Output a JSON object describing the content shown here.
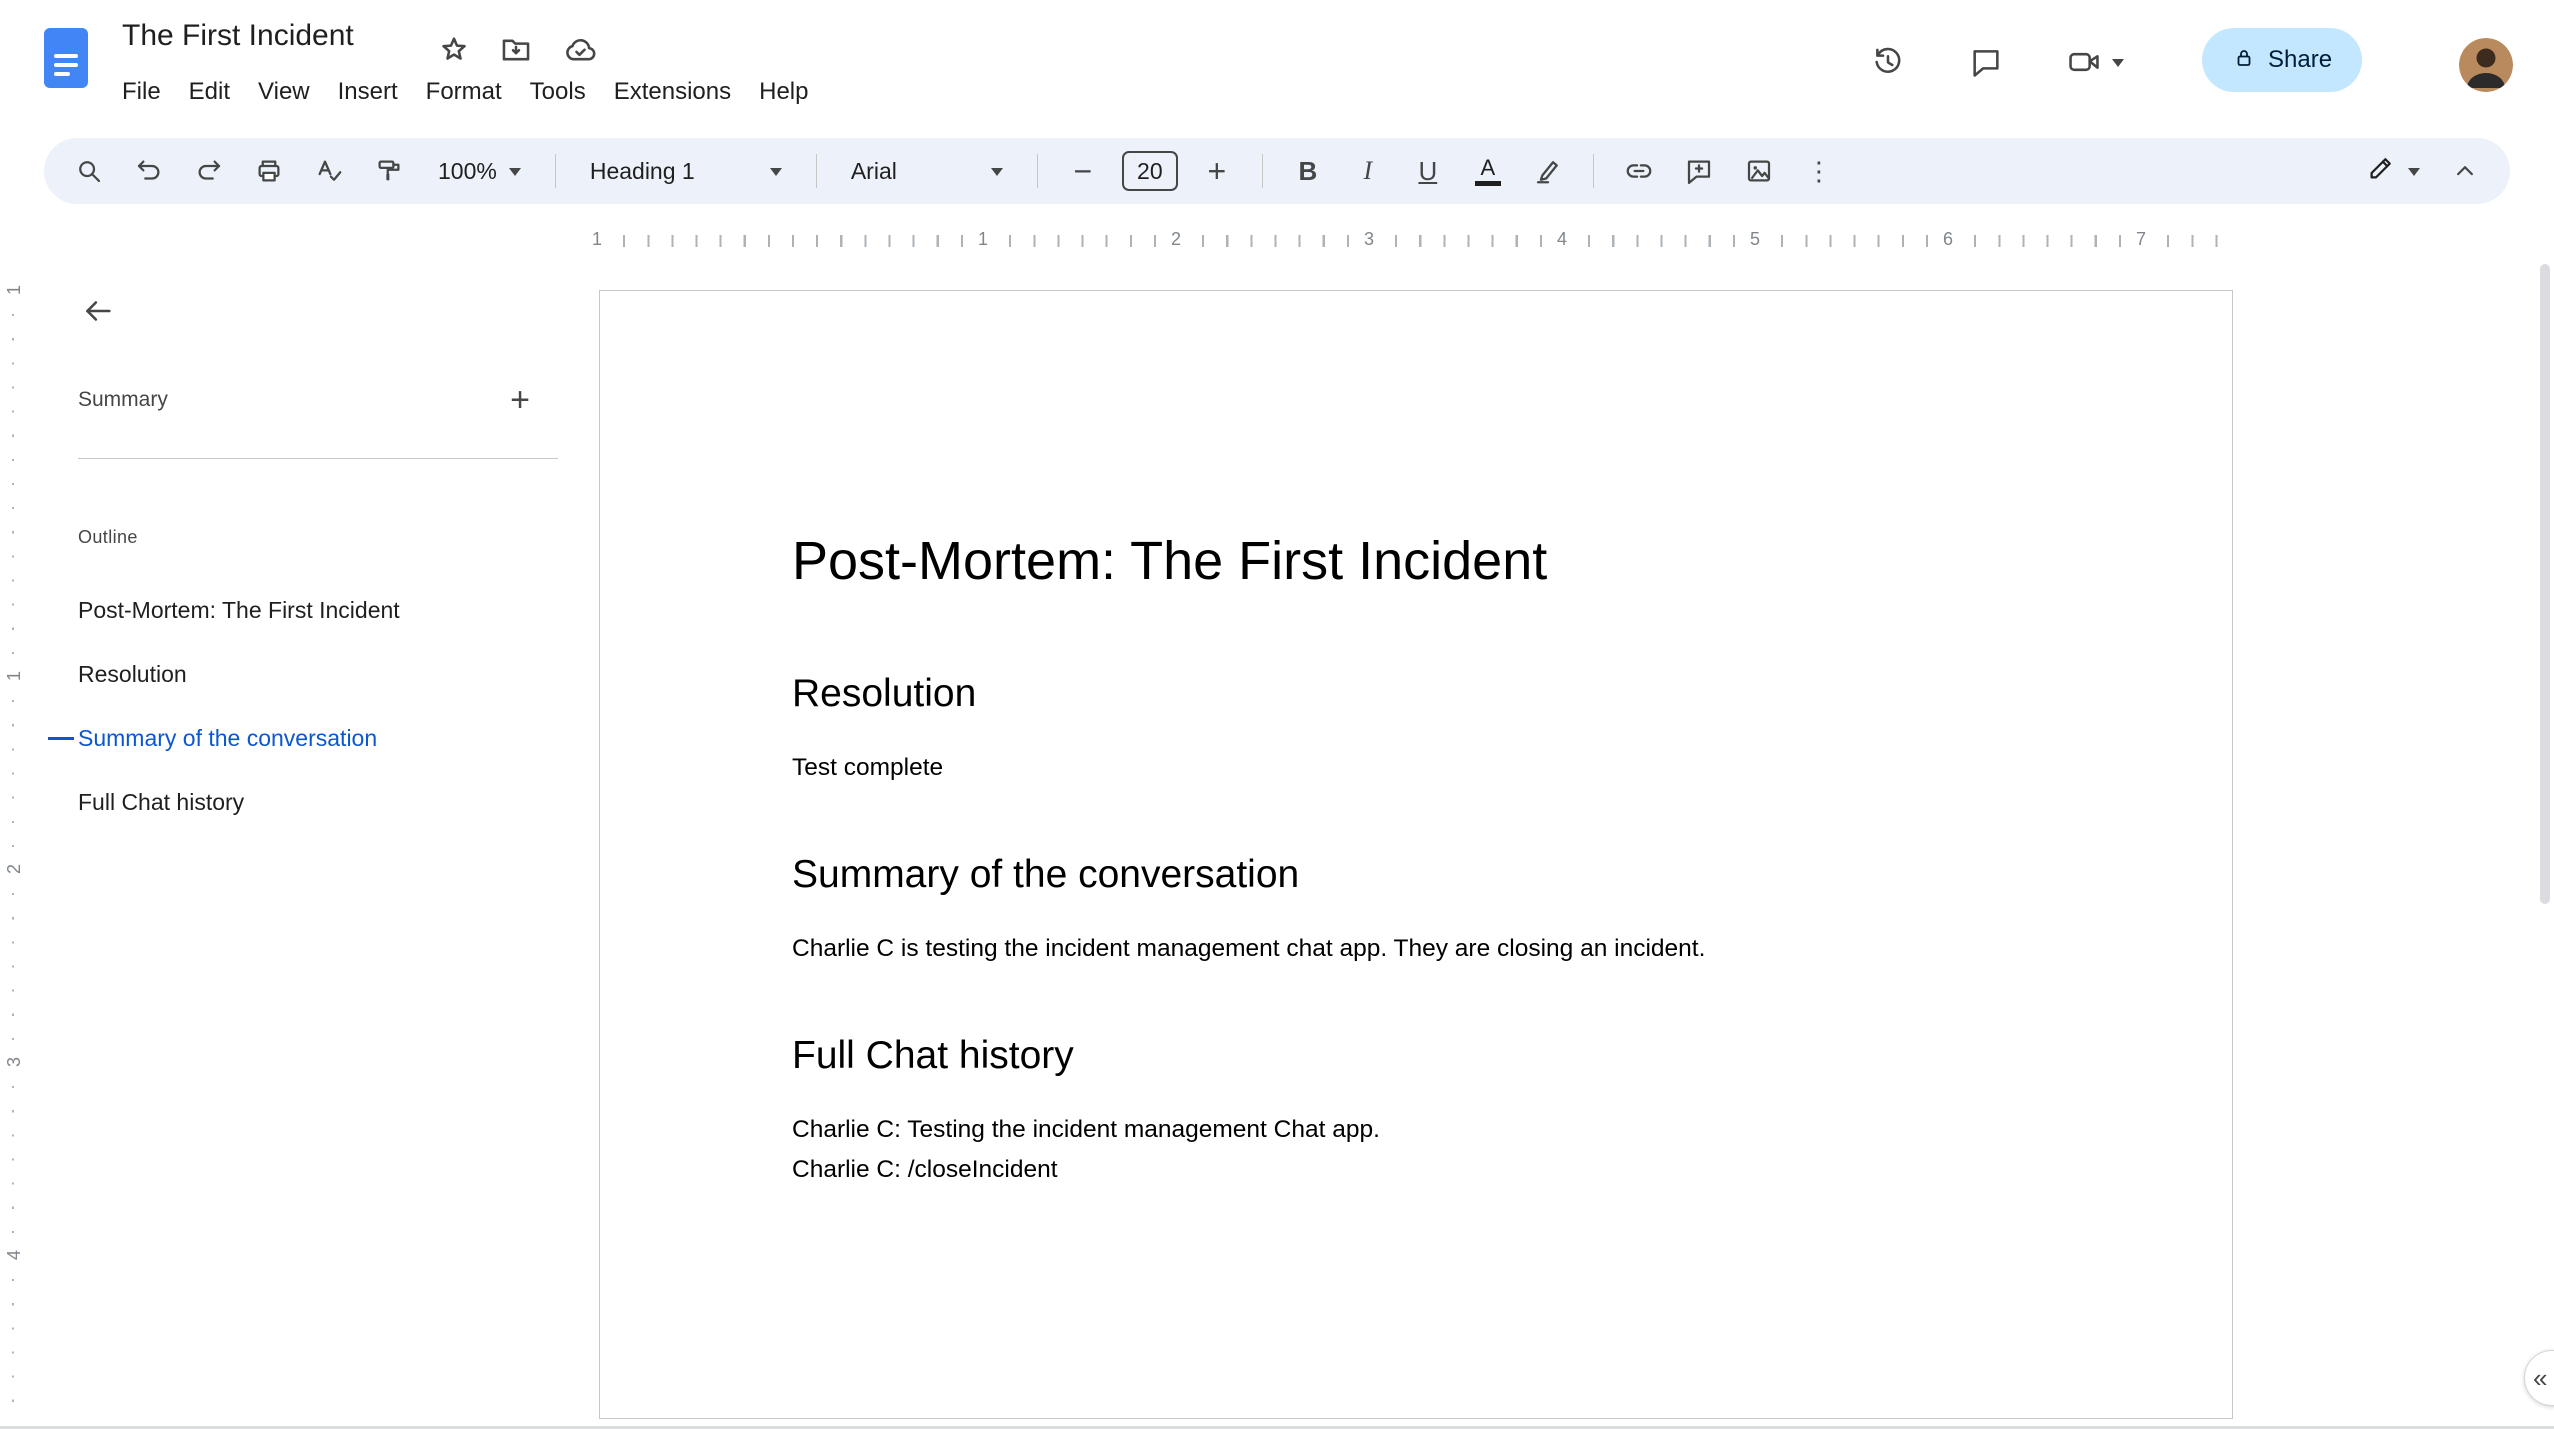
{
  "header": {
    "title": "The First Incident",
    "menus": [
      "File",
      "Edit",
      "View",
      "Insert",
      "Format",
      "Tools",
      "Extensions",
      "Help"
    ],
    "share_label": "Share"
  },
  "toolbar": {
    "zoom": "100%",
    "paragraph_style": "Heading 1",
    "font": "Arial",
    "font_size": "20"
  },
  "glyphs": {
    "bold": "B",
    "italic": "I",
    "underline": "U",
    "text_color": "A",
    "more": "⋮",
    "minus": "−",
    "plus": "+",
    "sidebar_add": "+",
    "collapse": "«"
  },
  "sidebar": {
    "summary_label": "Summary",
    "outline_label": "Outline",
    "items": [
      {
        "label": "Post-Mortem: The First Incident",
        "active": false
      },
      {
        "label": "Resolution",
        "active": false
      },
      {
        "label": "Summary of the conversation",
        "active": true
      },
      {
        "label": "Full Chat history",
        "active": false
      }
    ]
  },
  "ruler": {
    "numbers": [
      "1",
      "1",
      "2",
      "3",
      "4",
      "5",
      "6",
      "7"
    ]
  },
  "vruler": {
    "numbers": [
      "1",
      "1",
      "2",
      "3",
      "4"
    ]
  },
  "document": {
    "h1": "Post-Mortem: The First Incident",
    "sections": [
      {
        "heading": "Resolution",
        "paragraphs": [
          "Test complete"
        ]
      },
      {
        "heading": "Summary of the conversation",
        "paragraphs": [
          "Charlie C is testing the incident management chat app. They are closing an incident."
        ]
      },
      {
        "heading": "Full Chat history",
        "paragraphs": [
          "Charlie C: Testing the incident management Chat app.",
          "Charlie C: /closeIncident"
        ]
      }
    ]
  },
  "colors": {
    "accent": "#0b57d0",
    "toolbar_bg": "#edf2fa",
    "share_bg": "#c2e7ff",
    "share_text": "#001d35",
    "icon": "#444746",
    "ruler_marker": "#4285f4"
  }
}
